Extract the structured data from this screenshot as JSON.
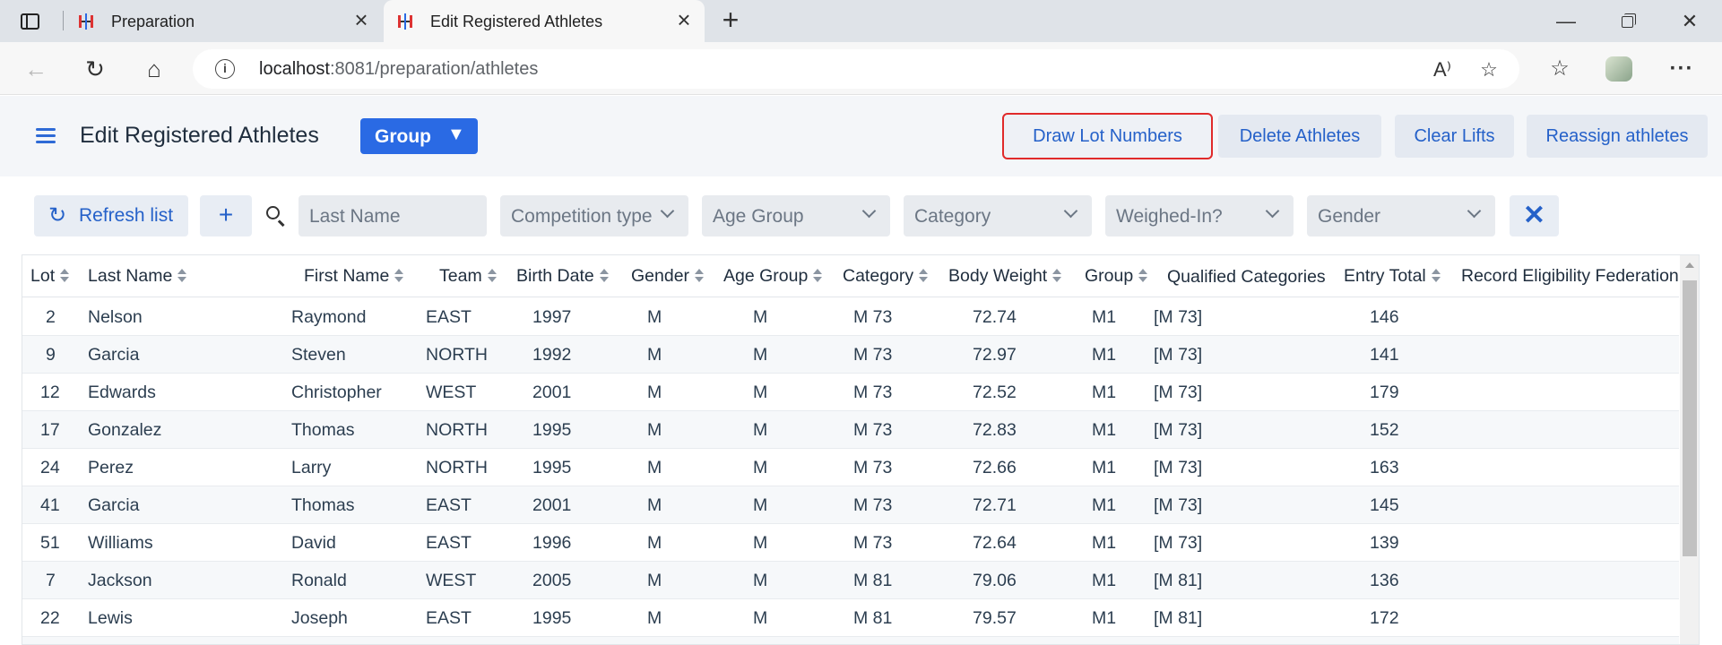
{
  "browser": {
    "tabs": [
      {
        "title": "Preparation",
        "active": false
      },
      {
        "title": "Edit Registered Athletes",
        "active": true
      }
    ],
    "url_host": "localhost",
    "url_path": ":8081/preparation/athletes",
    "icons": {
      "tab_actions": "tab-actions-icon",
      "new_tab": "plus-icon",
      "back": "back-arrow-icon",
      "reload": "reload-icon",
      "home": "home-icon",
      "site_info": "info-icon",
      "read_aloud": "read-aloud-icon",
      "add_favorite": "star-plus-icon",
      "favorites": "favorites-icon",
      "profile": "profile-avatar",
      "more": "more-icon"
    }
  },
  "header": {
    "title": "Edit Registered Athletes",
    "group_select": {
      "label": "Group",
      "arrow": "▼"
    },
    "buttons": {
      "draw": "Draw Lot Numbers",
      "delete": "Delete Athletes",
      "clear": "Clear Lifts",
      "reassign": "Reassign athletes"
    },
    "accent_color": "#2a6ae4",
    "highlight_color": "#e02a2a"
  },
  "filters": {
    "refresh": "Refresh list",
    "last_name": "Last Name",
    "competition_type": "Competition type",
    "age_group": "Age Group",
    "category": "Category",
    "weighed_in": "Weighed-In?",
    "gender": "Gender"
  },
  "grid": {
    "columns": [
      "Lot",
      "Last Name",
      "First Name",
      "Team",
      "Birth Date",
      "Gender",
      "Age Group",
      "Category",
      "Body Weight",
      "Group",
      "Qualified Categories",
      "Entry Total",
      "Record Eligibility Federations"
    ],
    "rows": [
      [
        "2",
        "Nelson",
        "Raymond",
        "EAST",
        "1997",
        "M",
        "M",
        "M 73",
        "72.74",
        "M1",
        "[M 73]",
        "146"
      ],
      [
        "9",
        "Garcia",
        "Steven",
        "NORTH",
        "1992",
        "M",
        "M",
        "M 73",
        "72.97",
        "M1",
        "[M 73]",
        "141"
      ],
      [
        "12",
        "Edwards",
        "Christopher",
        "WEST",
        "2001",
        "M",
        "M",
        "M 73",
        "72.52",
        "M1",
        "[M 73]",
        "179"
      ],
      [
        "17",
        "Gonzalez",
        "Thomas",
        "NORTH",
        "1995",
        "M",
        "M",
        "M 73",
        "72.83",
        "M1",
        "[M 73]",
        "152"
      ],
      [
        "24",
        "Perez",
        "Larry",
        "NORTH",
        "1995",
        "M",
        "M",
        "M 73",
        "72.66",
        "M1",
        "[M 73]",
        "163"
      ],
      [
        "41",
        "Garcia",
        "Thomas",
        "EAST",
        "2001",
        "M",
        "M",
        "M 73",
        "72.71",
        "M1",
        "[M 73]",
        "145"
      ],
      [
        "51",
        "Williams",
        "David",
        "EAST",
        "1996",
        "M",
        "M",
        "M 73",
        "72.64",
        "M1",
        "[M 73]",
        "139"
      ],
      [
        "7",
        "Jackson",
        "Ronald",
        "WEST",
        "2005",
        "M",
        "M",
        "M 81",
        "79.06",
        "M1",
        "[M 81]",
        "136"
      ],
      [
        "22",
        "Lewis",
        "Joseph",
        "EAST",
        "1995",
        "M",
        "M",
        "M 81",
        "79.57",
        "M1",
        "[M 81]",
        "172"
      ],
      [
        "",
        "",
        "",
        "",
        "",
        "",
        "",
        "",
        "",
        "",
        "",
        ""
      ]
    ]
  }
}
